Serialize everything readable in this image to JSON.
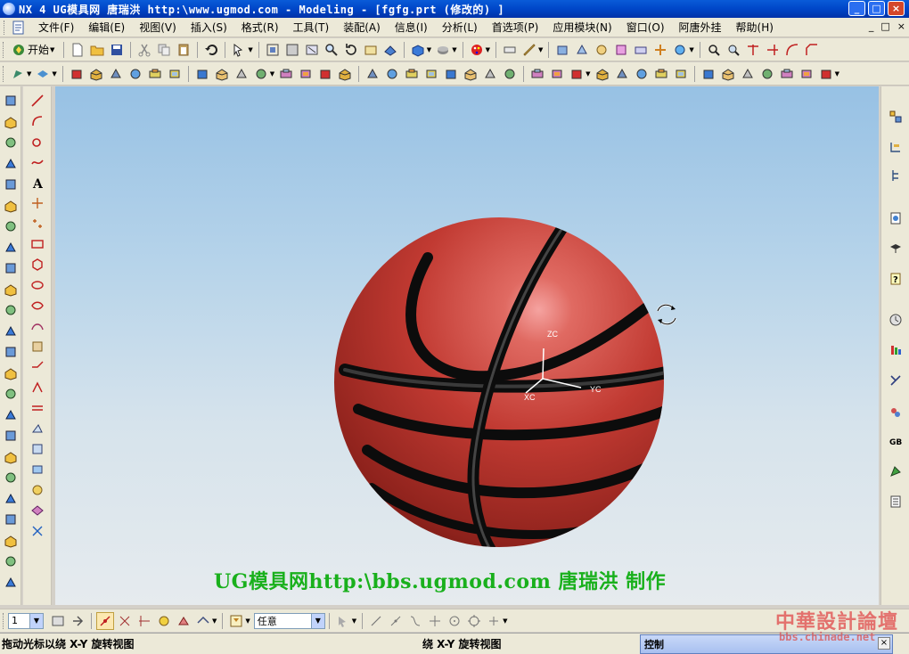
{
  "window": {
    "title": "NX 4 UG模具网  唐瑞洪  http:\\www.ugmod.com - Modeling - [fgfg.prt  (修改的) ]",
    "minimize": "_",
    "maximize": "□",
    "close": "×",
    "title_bar_color": "#0046c8"
  },
  "menubar": {
    "items": [
      "文件(F)",
      "编辑(E)",
      "视图(V)",
      "插入(S)",
      "格式(R)",
      "工具(T)",
      "装配(A)",
      "信息(I)",
      "分析(L)",
      "首选项(P)",
      "应用模块(N)",
      "窗口(O)",
      "阿唐外挂",
      "帮助(H)"
    ],
    "right_controls": [
      "_",
      "□",
      "×"
    ]
  },
  "toolbar1": {
    "start_label": "开始"
  },
  "viewport": {
    "background_top": "#97c1e4",
    "background_bottom": "#e6ebee",
    "model_color": "#c13a32",
    "axis_labels": {
      "z": "ZC",
      "x": "XC",
      "y": "YC"
    },
    "watermark": "UG模具网http:\\bbs.ugmod.com 唐瑞洪 制作",
    "watermark_color": "#19b01c",
    "rotate_cursor": "rotate-cursor-icon"
  },
  "bottombar": {
    "layer_value": "1",
    "filter_value": "任意"
  },
  "status": {
    "left_text": "拖动光标以绕 X-Y 旋转视图",
    "mid_text": "绕 X-Y 旋转视图"
  },
  "control_panel": {
    "title": "控制",
    "close": "×"
  },
  "corner_logo": {
    "title": "中華設計論壇",
    "url": "bbs.chinade.net"
  }
}
